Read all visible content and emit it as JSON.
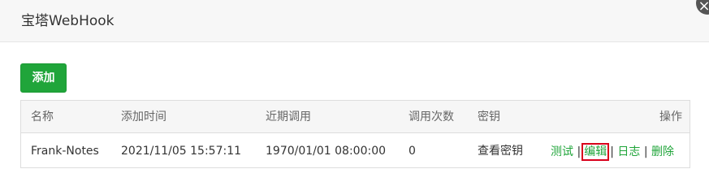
{
  "dialog": {
    "title": "宝塔WebHook",
    "close_icon": "×"
  },
  "toolbar": {
    "add_label": "添加"
  },
  "table": {
    "headers": [
      "名称",
      "添加时间",
      "近期调用",
      "调用次数",
      "密钥",
      "操作"
    ],
    "rows": [
      {
        "name": "Frank-Notes",
        "added_time": "2021/11/05 15:57:11",
        "last_called": "1970/01/01 08:00:00",
        "call_count": "0",
        "key_action": "查看密钥",
        "actions": {
          "test": "测试",
          "edit": "编辑",
          "log": "日志",
          "delete": "删除",
          "separator": "|"
        }
      }
    ]
  },
  "colors": {
    "accent_green": "#20a53a",
    "highlight_red": "#d9001b"
  }
}
